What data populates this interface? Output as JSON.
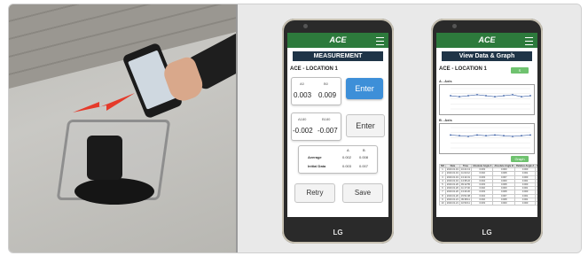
{
  "phone1": {
    "app_logo": "ACE",
    "title": "MEASUREMENT",
    "location": "ACE - LOCATION 1",
    "reading1": {
      "label_a": "A0",
      "label_b": "B0",
      "value_a": "0.003",
      "value_b": "0.009"
    },
    "enter1_label": "Enter",
    "reading2": {
      "label_a": "A180",
      "label_b": "B180",
      "value_a": "-0.002",
      "value_b": "-0.007"
    },
    "enter2_label": "Enter",
    "summary": {
      "col_a": "A",
      "col_b": "B",
      "rows": [
        {
          "label": "Average",
          "a": "0.002",
          "b": "0.008"
        },
        {
          "label": "Initial Data",
          "a": "0.003",
          "b": "0.007"
        }
      ]
    },
    "retry_label": "Retry",
    "save_label": "Save",
    "brand": "LG"
  },
  "phone2": {
    "app_logo": "ACE",
    "title": "View Data & Graph",
    "location": "ACE - LOCATION 1",
    "location_btn": "S",
    "chart_a_label": "A - Axis",
    "chart_b_label": "B - Axis",
    "toggle_btn": "Graph",
    "table": {
      "headers": [
        "NO",
        "Date",
        "Time",
        "Absolute Angle A",
        "Absolute Angle B",
        "Relative Angle A",
        "Relative Angle B"
      ],
      "rows": [
        [
          "1",
          "2016.01.19",
          "10:21:13",
          "0.003",
          "0.009",
          "0.000",
          "0.000"
        ],
        [
          "2",
          "2016.01.19",
          "11:02:12",
          "0.002",
          "0.008",
          "0.001",
          "0.001"
        ],
        [
          "3",
          "2016.01.19",
          "13:14:01",
          "0.003",
          "0.007",
          "0.000",
          "0.002"
        ],
        [
          "4",
          "2016.01.19",
          "14:35:22",
          "0.004",
          "0.009",
          "0.001",
          "0.000"
        ],
        [
          "5",
          "2016.01.20",
          "09:12:55",
          "0.003",
          "0.008",
          "0.000",
          "0.001"
        ],
        [
          "6",
          "2016.01.20",
          "11:17:46",
          "0.002",
          "0.009",
          "0.001",
          "0.000"
        ],
        [
          "7",
          "2016.01.20",
          "13:43:20",
          "0.003",
          "0.008",
          "0.000",
          "0.001"
        ],
        [
          "8",
          "2016.01.20",
          "15:51:08",
          "0.004",
          "0.007",
          "0.001",
          "0.002"
        ],
        [
          "9",
          "2016.01.21",
          "09:38:11",
          "0.002",
          "0.008",
          "0.001",
          "0.001"
        ],
        [
          "10",
          "2016.01.21",
          "10:53:11",
          "0.003",
          "0.009",
          "0.000",
          "0.000"
        ]
      ]
    },
    "chart_data": [
      {
        "type": "line",
        "title": "A - Axis",
        "x": [
          1,
          2,
          3,
          4,
          5,
          6,
          7,
          8,
          9,
          10
        ],
        "values": [
          0.003,
          0.002,
          0.003,
          0.004,
          0.003,
          0.002,
          0.003,
          0.004,
          0.002,
          0.003
        ],
        "ylim": [
          -0.01,
          0.01
        ]
      },
      {
        "type": "line",
        "title": "B - Axis",
        "x": [
          1,
          2,
          3,
          4,
          5,
          6,
          7,
          8,
          9,
          10
        ],
        "values": [
          0.009,
          0.008,
          0.007,
          0.009,
          0.008,
          0.009,
          0.008,
          0.007,
          0.008,
          0.009
        ],
        "ylim": [
          -0.01,
          0.02
        ]
      }
    ],
    "brand": "LG"
  },
  "colors": {
    "appbar": "#2d7a3c",
    "titlebar": "#1f3447",
    "enter_active": "#3d8fd8",
    "line": "#3f63a8"
  }
}
